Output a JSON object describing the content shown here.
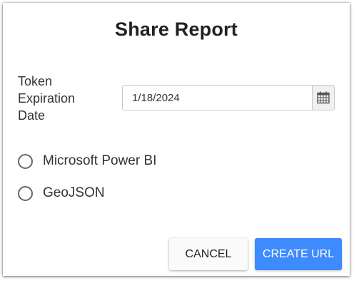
{
  "dialog": {
    "title": "Share Report"
  },
  "expiration": {
    "label_lines": [
      "Token",
      "Expiration",
      "Date"
    ],
    "value": "1/18/2024",
    "calendar_icon": "calendar-icon"
  },
  "formats": [
    {
      "label": "Microsoft Power BI",
      "selected": false
    },
    {
      "label": "GeoJSON",
      "selected": false
    }
  ],
  "actions": {
    "cancel_label": "CANCEL",
    "create_label": "CREATE URL"
  },
  "colors": {
    "primary": "#3d8bfd",
    "text": "#333333"
  }
}
